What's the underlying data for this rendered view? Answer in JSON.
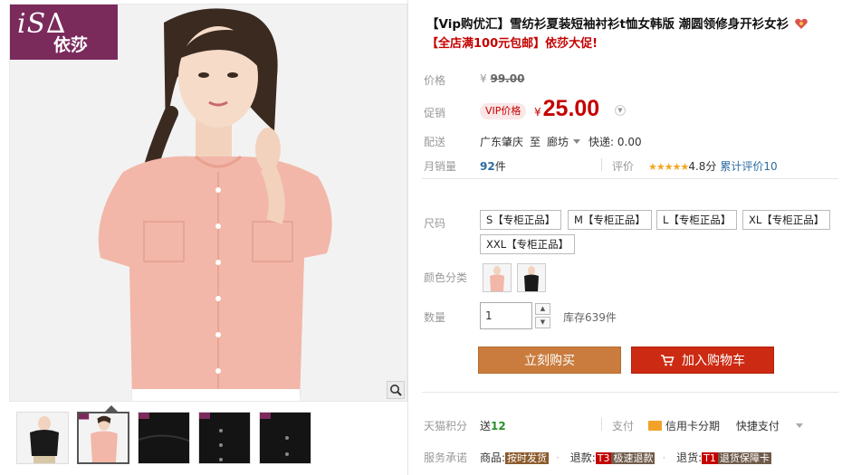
{
  "brand": {
    "logo_mark": "iS∆",
    "logo_cn": "依莎"
  },
  "product": {
    "title": "【Vip购优汇】雪纺衫夏装短袖衬衫t恤女韩版 潮圆领修身开衫女衫",
    "promo": "【全店满100元包邮】依莎大促!"
  },
  "price": {
    "label": "价格",
    "currency": "¥",
    "original": "99.00",
    "promo_label": "促销",
    "vip_tag": "VIP价格",
    "current": "25.00"
  },
  "shipping": {
    "label": "配送",
    "from": "广东肇庆",
    "to_word": "至",
    "to": "廊坊",
    "express": "快递: 0.00"
  },
  "sales": {
    "label": "月销量",
    "count": "92",
    "unit": "件",
    "rating_label": "评价",
    "stars": "★★★★★",
    "score": "4.8分",
    "reviews": "累计评价10"
  },
  "sku": {
    "size_label": "尺码",
    "sizes": [
      "S【专柜正品】",
      "M【专柜正品】",
      "L【专柜正品】",
      "XL【专柜正品】",
      "XXL【专柜正品】"
    ],
    "color_label": "颜色分类",
    "colors": [
      "pink",
      "black"
    ],
    "qty_label": "数量",
    "qty_value": "1",
    "stock": "库存639件"
  },
  "actions": {
    "buy_now": "立刻购买",
    "add_cart": "加入购物车"
  },
  "points": {
    "label": "天猫积分",
    "prefix": "送",
    "value": "12"
  },
  "payment": {
    "label": "支付",
    "card": "信用卡分期",
    "fast": "快捷支付"
  },
  "service": {
    "label": "服务承诺",
    "goods": "商品:",
    "goods_badge": "按时发货",
    "refund": "退款:",
    "refund_code": "T3",
    "refund_badge": "极速退款",
    "return": "退货:",
    "return_code": "T1",
    "return_badge": "退货保障卡"
  },
  "colors": {
    "accent_red": "#c40000",
    "buy_button": "#c97c3e",
    "cart_button": "#cc2a12",
    "logo_bg": "#7b2a5c"
  },
  "icons": [
    "zoom-icon",
    "cart-icon",
    "credit-card-icon",
    "chevron-down-icon",
    "tag-badge-icon"
  ]
}
